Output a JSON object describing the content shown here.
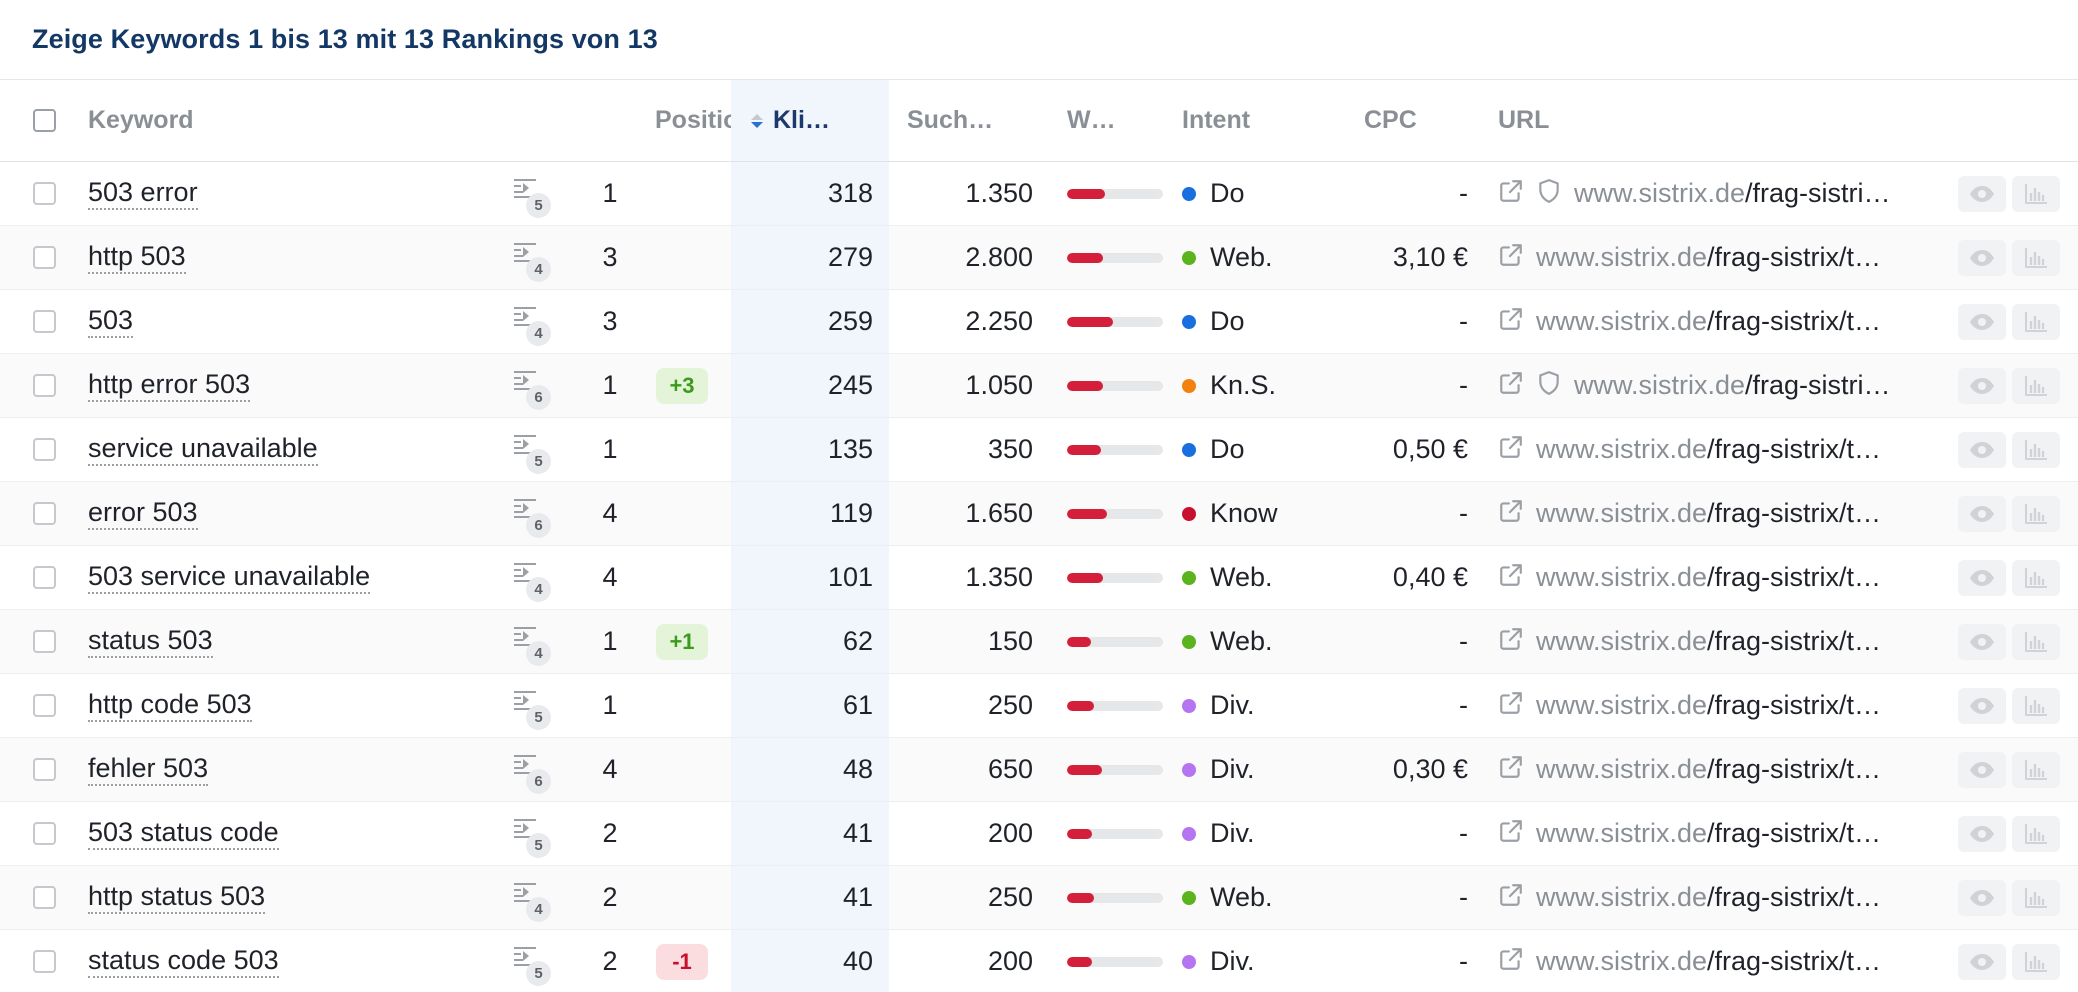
{
  "title": "Zeige Keywords 1 bis 13 mit 13 Rankings von 13",
  "columns": {
    "keyword": "Keyword",
    "position": "Position",
    "clicks": "Kli…",
    "search": "Such…",
    "w": "W…",
    "intent": "Intent",
    "cpc": "CPC",
    "url": "URL"
  },
  "intent_colors": {
    "Do": "#1a6fe0",
    "Web.": "#5bb31d",
    "Kn.S.": "#f2810f",
    "Know": "#c8102e",
    "Div.": "#b575f0"
  },
  "rows": [
    {
      "keyword": "503 error",
      "serp": "5",
      "position": "1",
      "delta": "",
      "clicks": "318",
      "search": "1.350",
      "w": 0.4,
      "intent": "Do",
      "cpc": "-",
      "shield": true,
      "host": "www.sistrix.de",
      "path": "/frag-sistrix/technisches-seo/"
    },
    {
      "keyword": "http 503",
      "serp": "4",
      "position": "3",
      "delta": "",
      "clicks": "279",
      "search": "2.800",
      "w": 0.38,
      "intent": "Web.",
      "cpc": "3,10 €",
      "shield": false,
      "host": "www.sistrix.de",
      "path": "/frag-sistrix/technisches-seo/"
    },
    {
      "keyword": "503",
      "serp": "4",
      "position": "3",
      "delta": "",
      "clicks": "259",
      "search": "2.250",
      "w": 0.48,
      "intent": "Do",
      "cpc": "-",
      "shield": false,
      "host": "www.sistrix.de",
      "path": "/frag-sistrix/technisches-seo/"
    },
    {
      "keyword": "http error 503",
      "serp": "6",
      "position": "1",
      "delta": "+3",
      "clicks": "245",
      "search": "1.050",
      "w": 0.38,
      "intent": "Kn.S.",
      "cpc": "-",
      "shield": true,
      "host": "www.sistrix.de",
      "path": "/frag-sistrix/technisches-seo/"
    },
    {
      "keyword": "service unavailable",
      "serp": "5",
      "position": "1",
      "delta": "",
      "clicks": "135",
      "search": "350",
      "w": 0.35,
      "intent": "Do",
      "cpc": "0,50 €",
      "shield": false,
      "host": "www.sistrix.de",
      "path": "/frag-sistrix/technisches-seo/"
    },
    {
      "keyword": "error 503",
      "serp": "6",
      "position": "4",
      "delta": "",
      "clicks": "119",
      "search": "1.650",
      "w": 0.42,
      "intent": "Know",
      "cpc": "-",
      "shield": false,
      "host": "www.sistrix.de",
      "path": "/frag-sistrix/technisches-seo/"
    },
    {
      "keyword": "503 service unavailable",
      "serp": "4",
      "position": "4",
      "delta": "",
      "clicks": "101",
      "search": "1.350",
      "w": 0.38,
      "intent": "Web.",
      "cpc": "0,40 €",
      "shield": false,
      "host": "www.sistrix.de",
      "path": "/frag-sistrix/technisches-seo/"
    },
    {
      "keyword": "status 503",
      "serp": "4",
      "position": "1",
      "delta": "+1",
      "clicks": "62",
      "search": "150",
      "w": 0.25,
      "intent": "Web.",
      "cpc": "-",
      "shield": false,
      "host": "www.sistrix.de",
      "path": "/frag-sistrix/technisches-seo/"
    },
    {
      "keyword": "http code 503",
      "serp": "5",
      "position": "1",
      "delta": "",
      "clicks": "61",
      "search": "250",
      "w": 0.28,
      "intent": "Div.",
      "cpc": "-",
      "shield": false,
      "host": "www.sistrix.de",
      "path": "/frag-sistrix/technisches-seo/"
    },
    {
      "keyword": "fehler 503",
      "serp": "6",
      "position": "4",
      "delta": "",
      "clicks": "48",
      "search": "650",
      "w": 0.36,
      "intent": "Div.",
      "cpc": "0,30 €",
      "shield": false,
      "host": "www.sistrix.de",
      "path": "/frag-sistrix/technisches-seo/"
    },
    {
      "keyword": "503 status code",
      "serp": "5",
      "position": "2",
      "delta": "",
      "clicks": "41",
      "search": "200",
      "w": 0.26,
      "intent": "Div.",
      "cpc": "-",
      "shield": false,
      "host": "www.sistrix.de",
      "path": "/frag-sistrix/technisches-seo/"
    },
    {
      "keyword": "http status 503",
      "serp": "4",
      "position": "2",
      "delta": "",
      "clicks": "41",
      "search": "250",
      "w": 0.28,
      "intent": "Web.",
      "cpc": "-",
      "shield": false,
      "host": "www.sistrix.de",
      "path": "/frag-sistrix/technisches-seo/"
    },
    {
      "keyword": "status code 503",
      "serp": "5",
      "position": "2",
      "delta": "-1",
      "clicks": "40",
      "search": "200",
      "w": 0.26,
      "intent": "Div.",
      "cpc": "-",
      "shield": false,
      "host": "www.sistrix.de",
      "path": "/frag-sistrix/technisches-seo/"
    }
  ]
}
